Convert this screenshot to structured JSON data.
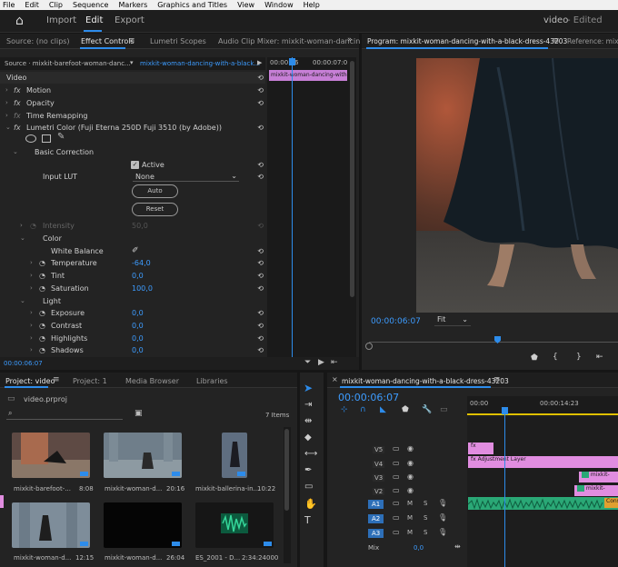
{
  "menu": [
    "File",
    "Edit",
    "Clip",
    "Sequence",
    "Markers",
    "Graphics and Titles",
    "View",
    "Window",
    "Help"
  ],
  "workspace": {
    "tabs": [
      "Import",
      "Edit",
      "Export"
    ],
    "active": "Edit",
    "project": "video",
    "status": "- Edited"
  },
  "source_panel": {
    "tabs": [
      "Source: (no clips)",
      "Effect Controls",
      "Lumetri Scopes",
      "Audio Clip Mixer: mixkit-woman-dancin"
    ],
    "active": "Effect Controls",
    "source_label": "Source · mixkit-barefoot-woman-danc...",
    "sequence_label": "mixkit-woman-dancing-with-a-black...",
    "time_a": "00:00:06",
    "time_b": "00:00:07:0",
    "clip_chip": "mixkit-woman-dancing-with-a-black-dress",
    "section_video": "Video",
    "rows": [
      {
        "label": "Motion",
        "kind": "fx"
      },
      {
        "label": "Opacity",
        "kind": "fx"
      },
      {
        "label": "Time Remapping",
        "kind": "fx"
      },
      {
        "label": "Lumetri Color (Fuji Eterna 250D Fuji 3510 (by Adobe))",
        "kind": "fx"
      }
    ],
    "basic_correction": "Basic Correction",
    "active_label": "Active",
    "input_lut_label": "Input LUT",
    "input_lut_value": "None",
    "auto_label": "Auto",
    "reset_label": "Reset",
    "intensity": {
      "label": "Intensity",
      "value": "50,0"
    },
    "color_label": "Color",
    "white_balance": "White Balance",
    "params": [
      {
        "label": "Temperature",
        "value": "-64,0"
      },
      {
        "label": "Tint",
        "value": "0,0"
      },
      {
        "label": "Saturation",
        "value": "100,0"
      }
    ],
    "light_label": "Light",
    "light_params": [
      {
        "label": "Exposure",
        "value": "0,0"
      },
      {
        "label": "Contrast",
        "value": "0,0"
      },
      {
        "label": "Highlights",
        "value": "0,0"
      },
      {
        "label": "Shadows",
        "value": "0,0"
      }
    ],
    "timecode": "00:00:06:07"
  },
  "program_panel": {
    "tabs": [
      "Program: mixkit-woman-dancing-with-a-black-dress-43203",
      "Reference: mixk"
    ],
    "timecode": "00:00:06:07",
    "fit": "Fit"
  },
  "project_panel": {
    "tabs": [
      "Project: video",
      "Project: 1",
      "Media Browser",
      "Libraries"
    ],
    "file": "video.prproj",
    "search_placeholder": "",
    "items_count": "7 Items",
    "items": [
      {
        "name": "mixkit-barefoot-...",
        "dur": "8:08"
      },
      {
        "name": "mixkit-woman-d...",
        "dur": "20:16"
      },
      {
        "name": "mixkit-ballerina-in...",
        "dur": "10:22"
      },
      {
        "name": "mixkit-woman-d...",
        "dur": "12:15"
      },
      {
        "name": "mixkit-woman-d...",
        "dur": "26:04"
      },
      {
        "name": "ES_2001 - D...",
        "dur": "2:34:24000"
      }
    ]
  },
  "timeline": {
    "tab": "mixkit-woman-dancing-with-a-black-dress-43203",
    "timecode": "00:00:06:07",
    "ruler": [
      "00:00",
      "00:00:14:23"
    ],
    "video_tracks": [
      "V5",
      "V4",
      "V3",
      "V2"
    ],
    "audio_tracks": [
      "A1",
      "A2",
      "A3"
    ],
    "mix_label": "Mix",
    "mix_value": "0,0",
    "adjustment_layer": "Adjustment Layer",
    "clip_labels": [
      "mixkit-",
      "mixkit-",
      "Cons"
    ]
  },
  "colors": {
    "accent": "#2d8ceb",
    "clip_pink": "#e18de0",
    "clip_green": "#2aa876"
  }
}
